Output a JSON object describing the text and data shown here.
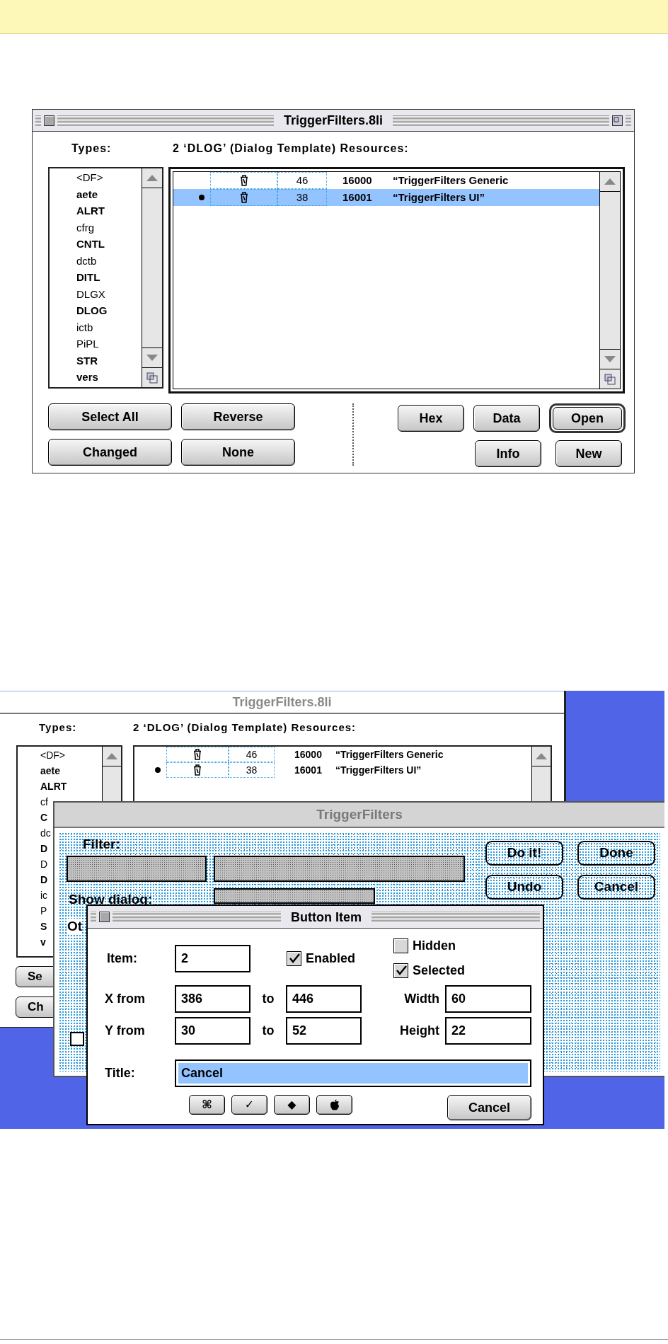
{
  "top_window": {
    "title": "TriggerFilters.8li",
    "types_label": "Types:",
    "resources_label": "2 ‘DLOG’ (Dialog Template) Resources:",
    "types": [
      {
        "name": "<DF>",
        "bold": false
      },
      {
        "name": "aete",
        "bold": true
      },
      {
        "name": "ALRT",
        "bold": true
      },
      {
        "name": "cfrg",
        "bold": false
      },
      {
        "name": "CNTL",
        "bold": true
      },
      {
        "name": "dctb",
        "bold": false
      },
      {
        "name": "DITL",
        "bold": true
      },
      {
        "name": "DLGX",
        "bold": false
      },
      {
        "name": "DLOG",
        "bold": true
      },
      {
        "name": "ictb",
        "bold": false
      },
      {
        "name": "PiPL",
        "bold": false
      },
      {
        "name": "STR",
        "bold": true
      },
      {
        "name": "vers",
        "bold": true
      }
    ],
    "resources": [
      {
        "marked": false,
        "size": "46",
        "id": "16000",
        "name": "“TriggerFilters Generic",
        "selected": false
      },
      {
        "marked": true,
        "size": "38",
        "id": "16001",
        "name": "“TriggerFilters UI”",
        "selected": true
      }
    ],
    "button_rows": [
      {
        "left": [
          {
            "label": "Select All",
            "default": false
          },
          {
            "label": "Reverse",
            "default": false
          }
        ],
        "right": [
          {
            "label": "Hex",
            "default": false
          },
          {
            "label": "Data",
            "default": false
          },
          {
            "label": "Open",
            "default": true
          }
        ]
      },
      {
        "left": [
          {
            "label": "Changed",
            "default": false
          },
          {
            "label": "None",
            "default": false
          }
        ],
        "right": [
          {
            "label": "Info",
            "default": false
          },
          {
            "label": "New",
            "default": false
          }
        ]
      }
    ]
  },
  "desktop": {
    "back_window": {
      "title": "TriggerFilters.8li",
      "types_label": "Types:",
      "resources_label": "2 ‘DLOG’ (Dialog Template) Resources:",
      "types": [
        {
          "name": "<DF>",
          "bold": false
        },
        {
          "name": "aete",
          "bold": true
        },
        {
          "name": "ALRT",
          "bold": true
        },
        {
          "name": "cf",
          "bold": false
        },
        {
          "name": "C",
          "bold": true
        },
        {
          "name": "dc",
          "bold": false
        },
        {
          "name": "D",
          "bold": true
        },
        {
          "name": "D",
          "bold": false
        },
        {
          "name": "D",
          "bold": true
        },
        {
          "name": "ic",
          "bold": false
        },
        {
          "name": "P",
          "bold": false
        },
        {
          "name": "S",
          "bold": true
        },
        {
          "name": "v",
          "bold": true
        }
      ],
      "resources": [
        {
          "marked": false,
          "size": "46",
          "id": "16000",
          "name": "“TriggerFilters Generic"
        },
        {
          "marked": true,
          "size": "38",
          "id": "16001",
          "name": "“TriggerFilters UI”"
        }
      ],
      "buttons": [
        "Se",
        "Ch"
      ]
    },
    "dialog_window": {
      "title": "TriggerFilters",
      "filter_label": "Filter:",
      "show_label": "Show dialog:",
      "other_label": "Ot",
      "buttons": [
        "Do it!",
        "Done",
        "Undo",
        "Cancel"
      ]
    },
    "button_item": {
      "title": "Button Item",
      "item_label": "Item:",
      "item_value": "2",
      "checks": [
        {
          "label": "Enabled",
          "checked": true
        },
        {
          "label": "Hidden",
          "checked": false
        },
        {
          "label": "Selected",
          "checked": true
        }
      ],
      "coords": [
        {
          "label": "X from",
          "from": "386",
          "to_label": "to",
          "to": "446",
          "size_label": "Width",
          "size": "60"
        },
        {
          "label": "Y from",
          "from": "30",
          "to_label": "to",
          "to": "52",
          "size_label": "Height",
          "size": "22"
        }
      ],
      "title_label": "Title:",
      "title_value": "Cancel",
      "title_selected": true,
      "symbol_buttons": [
        {
          "kind": "text",
          "label": "⌘"
        },
        {
          "kind": "text",
          "label": "✓"
        },
        {
          "kind": "text",
          "label": "◆"
        },
        {
          "kind": "apple"
        }
      ],
      "cancel_button": "Cancel"
    }
  }
}
